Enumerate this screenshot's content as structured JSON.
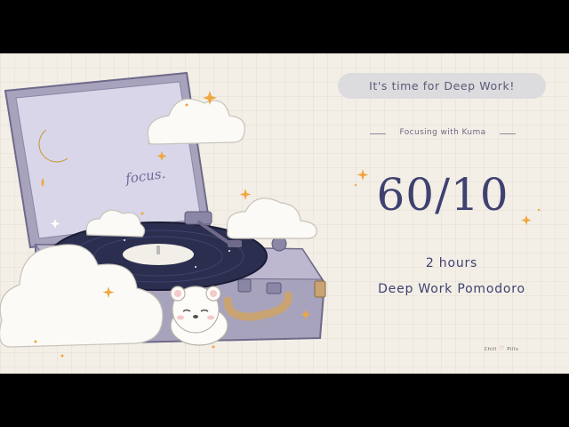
{
  "banner": "It's time for Deep Work!",
  "subtitle": "Focusing with Kuma",
  "ratio": "60/10",
  "duration": "2 hours",
  "session_title": "Deep Work Pomodoro",
  "brand": {
    "left": "Chill",
    "right": "Pills"
  },
  "screen_text": "focus.",
  "colors": {
    "background": "#f3efe7",
    "text_navy": "#3f4170",
    "pill_bg": "#dcdcde",
    "case_purple": "#a8a3bc",
    "screen_lavender": "#d8d6e8",
    "record_dark": "#2b2e4e",
    "moon_yellow": "#f7c64a",
    "sparkle_orange": "#f0a640",
    "handle_tan": "#c9a372"
  }
}
